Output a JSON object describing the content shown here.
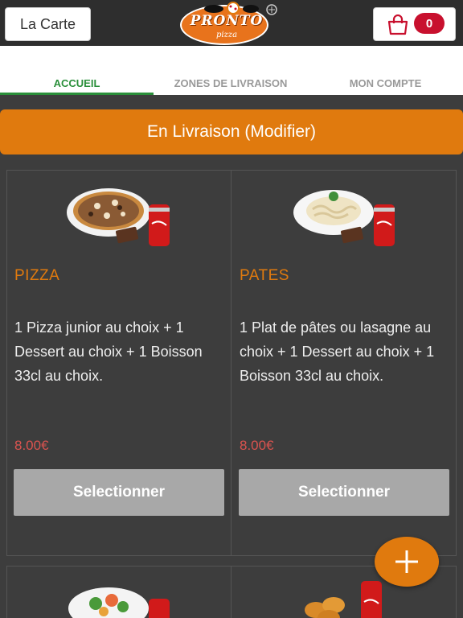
{
  "header": {
    "menu_button": "La Carte",
    "logo_text": "PRONTO",
    "logo_sub": "pizza",
    "cart_count": "0"
  },
  "tabs": [
    {
      "label": "ACCUEIL",
      "active": true
    },
    {
      "label": "ZONES DE LIVRAISON",
      "active": false
    },
    {
      "label": "MON COMPTE",
      "active": false
    }
  ],
  "delivery_banner": "En Livraison (Modifier)",
  "products": [
    {
      "title": "PIZZA",
      "description": "1 Pizza junior au choix  + 1 Dessert au choix  + 1 Boisson 33cl au choix.",
      "price": "8.00€",
      "button": "Selectionner",
      "image_icon": "pizza-menu-image"
    },
    {
      "title": "PATES",
      "description": "1 Plat de pâtes ou lasagne au choix  + 1 Dessert au choix  + 1 Boisson 33cl au choix.",
      "price": "8.00€",
      "button": "Selectionner",
      "image_icon": "pasta-menu-image"
    }
  ],
  "colors": {
    "accent": "#e07a0e",
    "active_tab": "#2a8f3a",
    "price": "#d9534f",
    "badge": "#c8102e"
  }
}
